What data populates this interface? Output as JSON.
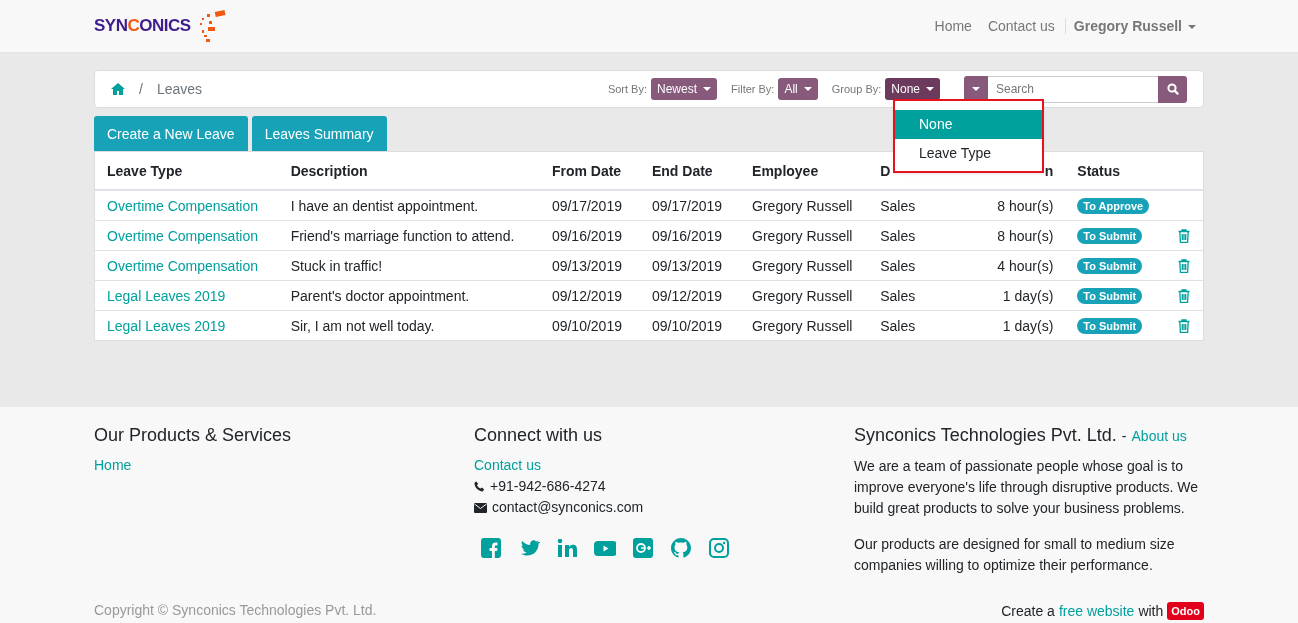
{
  "header": {
    "logo": [
      {
        "text": "SYN",
        "accent": false
      },
      {
        "text": "C",
        "accent": true
      },
      {
        "text": "ONICS",
        "accent": false
      }
    ],
    "nav": [
      {
        "label": "Home"
      },
      {
        "label": "Contact us"
      }
    ],
    "user": "Gregory Russell"
  },
  "breadcrumb": {
    "separator": "/",
    "current": "Leaves"
  },
  "controls": [
    {
      "label": "Sort By:",
      "value": "Newest",
      "open": false
    },
    {
      "label": "Filter By:",
      "value": "All",
      "open": false
    },
    {
      "label": "Group By:",
      "value": "None",
      "open": true
    }
  ],
  "search": {
    "placeholder": "Search"
  },
  "dropdown": {
    "highlighted": true,
    "items": [
      {
        "label": "None",
        "selected": true
      },
      {
        "label": "Leave Type",
        "selected": false
      }
    ]
  },
  "buttons": [
    "Create a New Leave",
    "Leaves Summary"
  ],
  "table": {
    "columns": [
      {
        "label": "Leave Type"
      },
      {
        "label": "Description"
      },
      {
        "label": "From Date"
      },
      {
        "label": "End Date"
      },
      {
        "label": "Employee"
      },
      {
        "label": "D"
      },
      {
        "label": "n"
      },
      {
        "label": "Status"
      }
    ],
    "rows": [
      {
        "leave_type": "Overtime Compensation",
        "description": "I have an dentist appointment.",
        "from_date": "09/17/2019",
        "end_date": "09/17/2019",
        "employee": "Gregory Russell",
        "department": "Sales",
        "duration": "8 hour(s)",
        "status": "To Approve",
        "deletable": false
      },
      {
        "leave_type": "Overtime Compensation",
        "description": "Friend's marriage function to attend.",
        "from_date": "09/16/2019",
        "end_date": "09/16/2019",
        "employee": "Gregory Russell",
        "department": "Sales",
        "duration": "8 hour(s)",
        "status": "To Submit",
        "deletable": true
      },
      {
        "leave_type": "Overtime Compensation",
        "description": "Stuck in traffic!",
        "from_date": "09/13/2019",
        "end_date": "09/13/2019",
        "employee": "Gregory Russell",
        "department": "Sales",
        "duration": "4 hour(s)",
        "status": "To Submit",
        "deletable": true
      },
      {
        "leave_type": "Legal Leaves 2019",
        "description": "Parent's doctor appointment.",
        "from_date": "09/12/2019",
        "end_date": "09/12/2019",
        "employee": "Gregory Russell",
        "department": "Sales",
        "duration": "1 day(s)",
        "status": "To Submit",
        "deletable": true
      },
      {
        "leave_type": "Legal Leaves 2019",
        "description": "Sir, I am not well today.",
        "from_date": "09/10/2019",
        "end_date": "09/10/2019",
        "employee": "Gregory Russell",
        "department": "Sales",
        "duration": "1 day(s)",
        "status": "To Submit",
        "deletable": true
      }
    ]
  },
  "footer": {
    "products": {
      "title": "Our Products & Services",
      "links": [
        "Home"
      ]
    },
    "connect": {
      "title": "Connect with us",
      "link": "Contact us",
      "phone": "+91-942-686-4274",
      "email": "contact@synconics.com"
    },
    "company": {
      "title": "Synconics Technologies Pvt. Ltd.",
      "separator": "-",
      "link": "About us",
      "paragraphs": [
        "We are a team of passionate people whose goal is to improve everyone's life through disruptive products. We build great products to solve your business problems.",
        "Our products are designed for small to medium size companies willing to optimize their performance."
      ]
    },
    "copyright": "Copyright © Synconics Technologies Pvt. Ltd.",
    "credit": {
      "before": "Create a",
      "link": "free website",
      "after": "with",
      "badge": "Odoo"
    }
  }
}
